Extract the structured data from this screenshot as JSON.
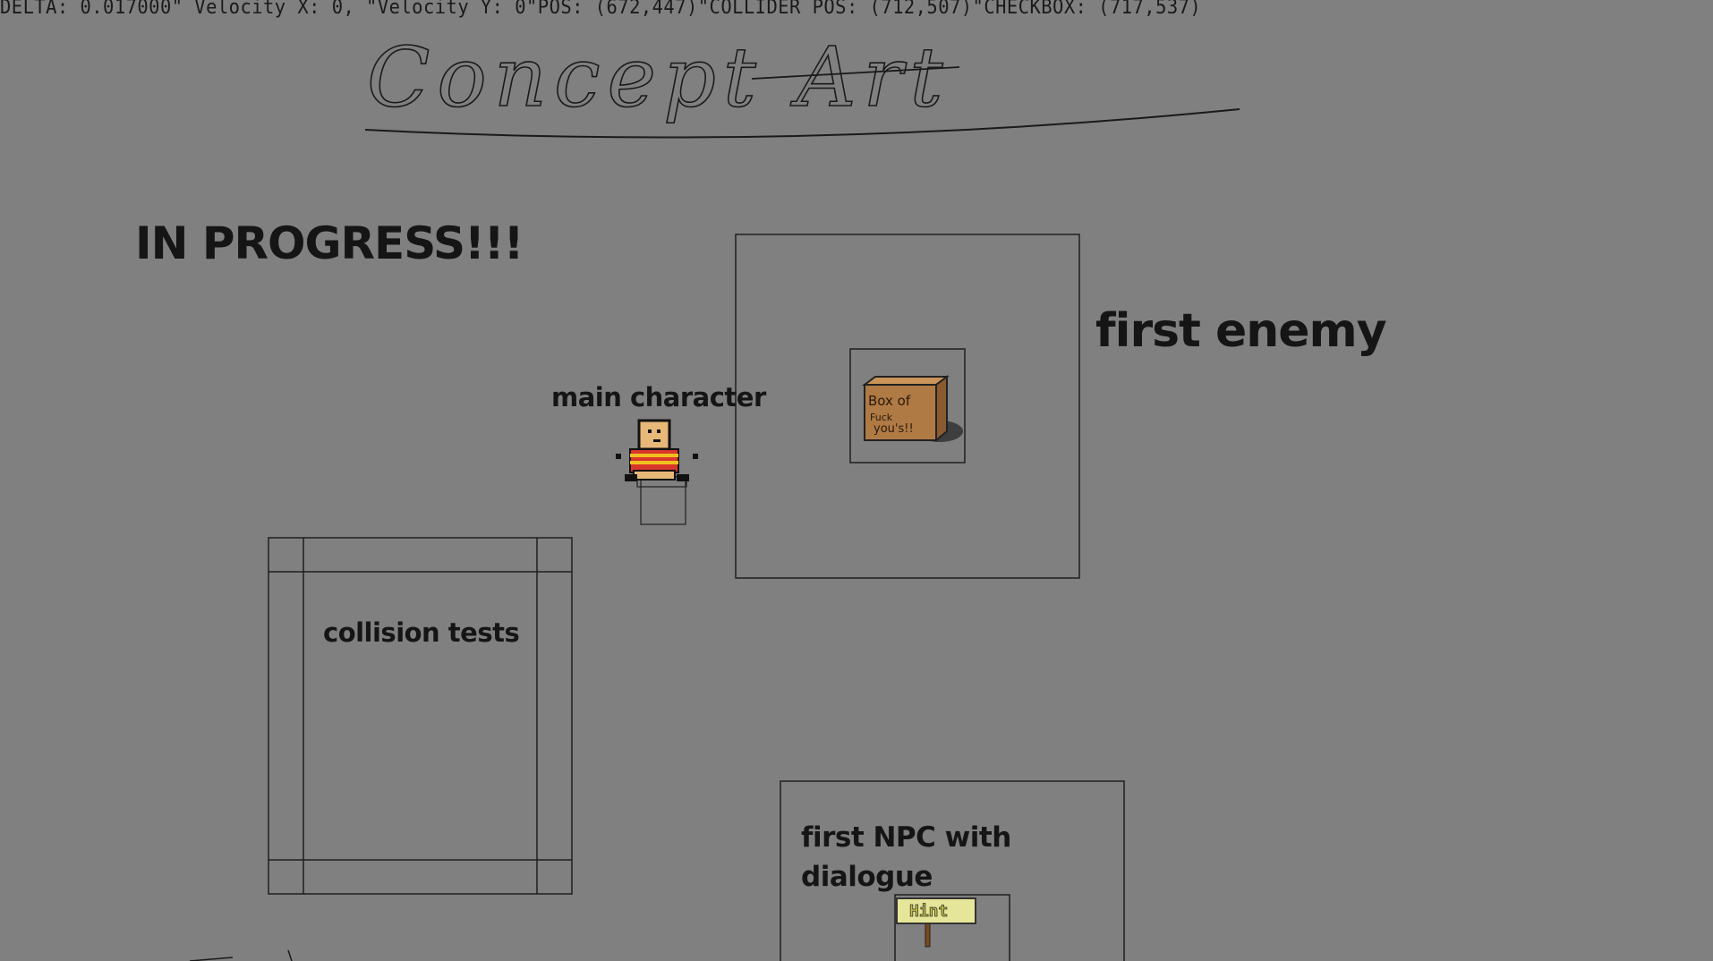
{
  "debug": {
    "text": "DELTA: 0.017000\" Velocity X: 0, \"Velocity Y: 0\"POS: (672,447)\"COLLIDER POS: (712,507)\"CHECKBOX: (717,537)"
  },
  "title": {
    "text": "Concept Art"
  },
  "labels": {
    "in_progress": "IN PROGRESS!!!",
    "main_character": "main character",
    "first_enemy": "first enemy",
    "collision_tests": "collision tests",
    "npc_line1": "first NPC with",
    "npc_line2": "dialogue"
  },
  "sprites": {
    "box_text_1": "Box of",
    "box_text_2": "Fuck",
    "box_text_3": "you's!!",
    "sign_text": "Hint"
  },
  "colors": {
    "background": "#808080",
    "outline": "#1f1f1f",
    "box_brown": "#b07a45",
    "shirt_red": "#d8362b",
    "shirt_yellow": "#f0c020",
    "skin": "#e8b878",
    "sign_yellow": "#e6e69a"
  }
}
